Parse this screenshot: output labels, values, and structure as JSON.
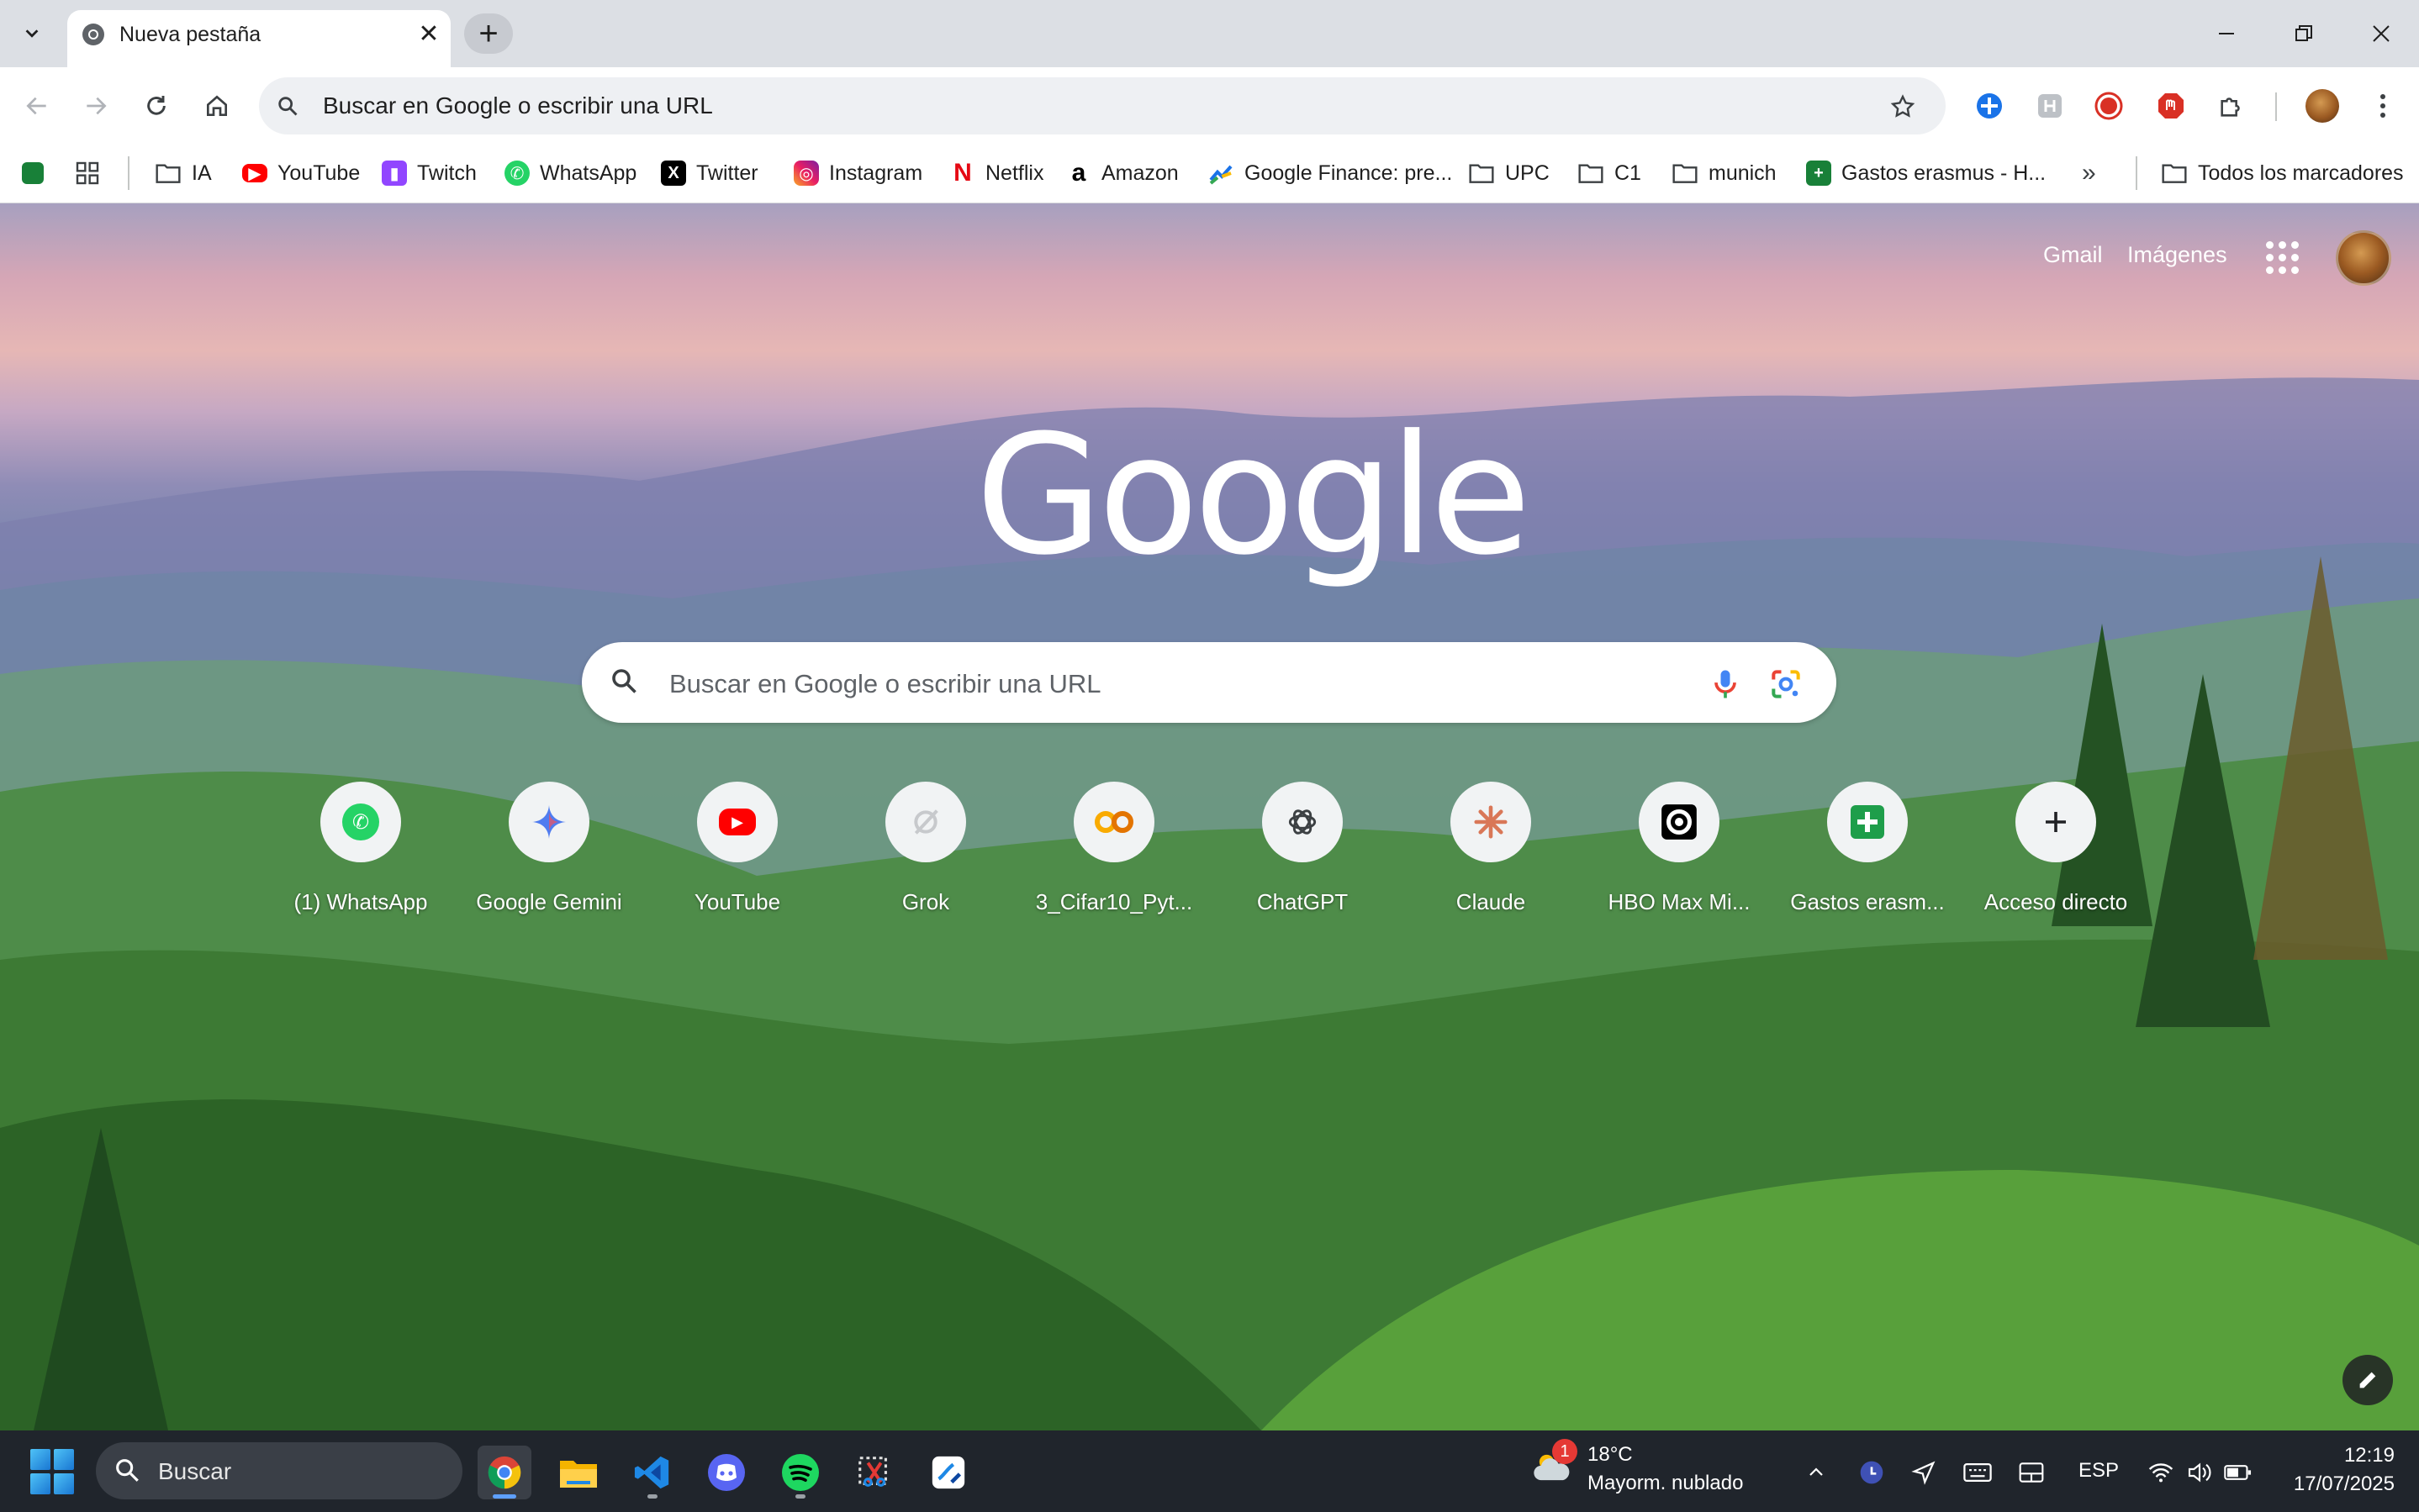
{
  "browser": {
    "tab": {
      "title": "Nueva pestaña"
    },
    "omnibox": {
      "placeholder": "Buscar en Google o escribir una URL"
    }
  },
  "bookmarks": [
    {
      "label": "IA",
      "icon": "folder-icon"
    },
    {
      "label": "YouTube",
      "icon": "youtube-icon"
    },
    {
      "label": "Twitch",
      "icon": "twitch-icon"
    },
    {
      "label": "WhatsApp",
      "icon": "whatsapp-icon"
    },
    {
      "label": "Twitter",
      "icon": "x-icon"
    },
    {
      "label": "Instagram",
      "icon": "instagram-icon"
    },
    {
      "label": "Netflix",
      "icon": "netflix-icon"
    },
    {
      "label": "Amazon",
      "icon": "amazon-icon"
    },
    {
      "label": "Google Finance: pre...",
      "icon": "google-finance-icon"
    },
    {
      "label": "UPC",
      "icon": "folder-icon"
    },
    {
      "label": "C1",
      "icon": "folder-icon"
    },
    {
      "label": "munich",
      "icon": "folder-icon"
    },
    {
      "label": "Gastos erasmus - H...",
      "icon": "sheets-icon"
    },
    {
      "label": "Todos los marcadores",
      "icon": "folder-icon"
    }
  ],
  "ntp": {
    "links": {
      "gmail": "Gmail",
      "images": "Imágenes"
    },
    "logo": "Google",
    "search_placeholder": "Buscar en Google o escribir una URL",
    "shortcuts": [
      {
        "label": "(1) WhatsApp",
        "icon": "whatsapp-icon"
      },
      {
        "label": "Google Gemini",
        "icon": "gemini-icon"
      },
      {
        "label": "YouTube",
        "icon": "youtube-icon"
      },
      {
        "label": "Grok",
        "icon": "grok-icon"
      },
      {
        "label": "3_Cifar10_Pyt...",
        "icon": "colab-icon"
      },
      {
        "label": "ChatGPT",
        "icon": "chatgpt-icon"
      },
      {
        "label": "Claude",
        "icon": "claude-icon"
      },
      {
        "label": "HBO Max Mi...",
        "icon": "hbo-max-icon"
      },
      {
        "label": "Gastos erasm...",
        "icon": "sheets-icon"
      },
      {
        "label": "Acceso directo",
        "icon": "plus-icon"
      }
    ]
  },
  "taskbar": {
    "search_placeholder": "Buscar",
    "weather": {
      "badge": "1",
      "temp": "18°C",
      "desc": "Mayorm. nublado"
    },
    "language": "ESP",
    "time": "12:19",
    "date": "17/07/2025"
  },
  "colors": {
    "tabstrip": "#dcdfe4",
    "omnibox": "#eef0f3",
    "taskbar": "#20252c"
  }
}
